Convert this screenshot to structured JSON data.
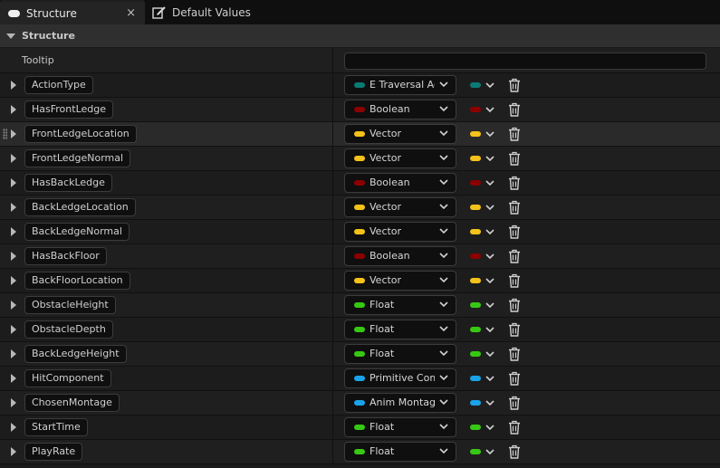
{
  "tabs": [
    {
      "label": "Structure",
      "close": "×"
    },
    {
      "label": "Default Values"
    }
  ],
  "section": {
    "title": "Structure"
  },
  "tooltip": {
    "label": "Tooltip",
    "value": ""
  },
  "colors": {
    "enum": "#0b7a74",
    "boolean": "#8c0000",
    "vector": "#f5c21b",
    "float": "#37c814",
    "object": "#1aa3e8"
  },
  "variables": [
    {
      "name": "ActionType",
      "type": "E Traversal Action",
      "color": "#0b7a74"
    },
    {
      "name": "HasFrontLedge",
      "type": "Boolean",
      "color": "#8c0000"
    },
    {
      "name": "FrontLedgeLocation",
      "type": "Vector",
      "color": "#f5c21b"
    },
    {
      "name": "FrontLedgeNormal",
      "type": "Vector",
      "color": "#f5c21b"
    },
    {
      "name": "HasBackLedge",
      "type": "Boolean",
      "color": "#8c0000"
    },
    {
      "name": "BackLedgeLocation",
      "type": "Vector",
      "color": "#f5c21b"
    },
    {
      "name": "BackLedgeNormal",
      "type": "Vector",
      "color": "#f5c21b"
    },
    {
      "name": "HasBackFloor",
      "type": "Boolean",
      "color": "#8c0000"
    },
    {
      "name": "BackFloorLocation",
      "type": "Vector",
      "color": "#f5c21b"
    },
    {
      "name": "ObstacleHeight",
      "type": "Float",
      "color": "#37c814"
    },
    {
      "name": "ObstacleDepth",
      "type": "Float",
      "color": "#37c814"
    },
    {
      "name": "BackLedgeHeight",
      "type": "Float",
      "color": "#37c814"
    },
    {
      "name": "HitComponent",
      "type": "Primitive Component",
      "color": "#1aa3e8"
    },
    {
      "name": "ChosenMontage",
      "type": "Anim Montage",
      "color": "#1aa3e8"
    },
    {
      "name": "StartTime",
      "type": "Float",
      "color": "#37c814"
    },
    {
      "name": "PlayRate",
      "type": "Float",
      "color": "#37c814"
    }
  ]
}
